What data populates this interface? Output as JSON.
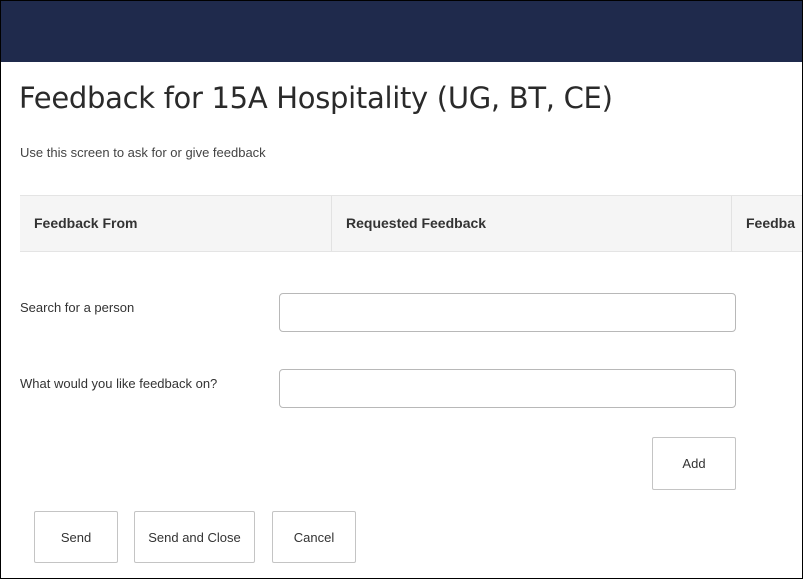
{
  "header": {
    "title": "Feedback for 15A Hospitality (UG, BT, CE)",
    "subtitle": "Use this screen to ask for or give feedback"
  },
  "table": {
    "columns": [
      "Feedback From",
      "Requested Feedback",
      "Feedba"
    ]
  },
  "form": {
    "search_label": "Search for a person",
    "search_value": "",
    "topic_label": "What would you like feedback on?",
    "topic_value": ""
  },
  "buttons": {
    "add": "Add",
    "send": "Send",
    "send_close": "Send and Close",
    "cancel": "Cancel"
  },
  "colors": {
    "top_bar": "#1f2a4c",
    "header_bar": "#f5f5f5"
  }
}
